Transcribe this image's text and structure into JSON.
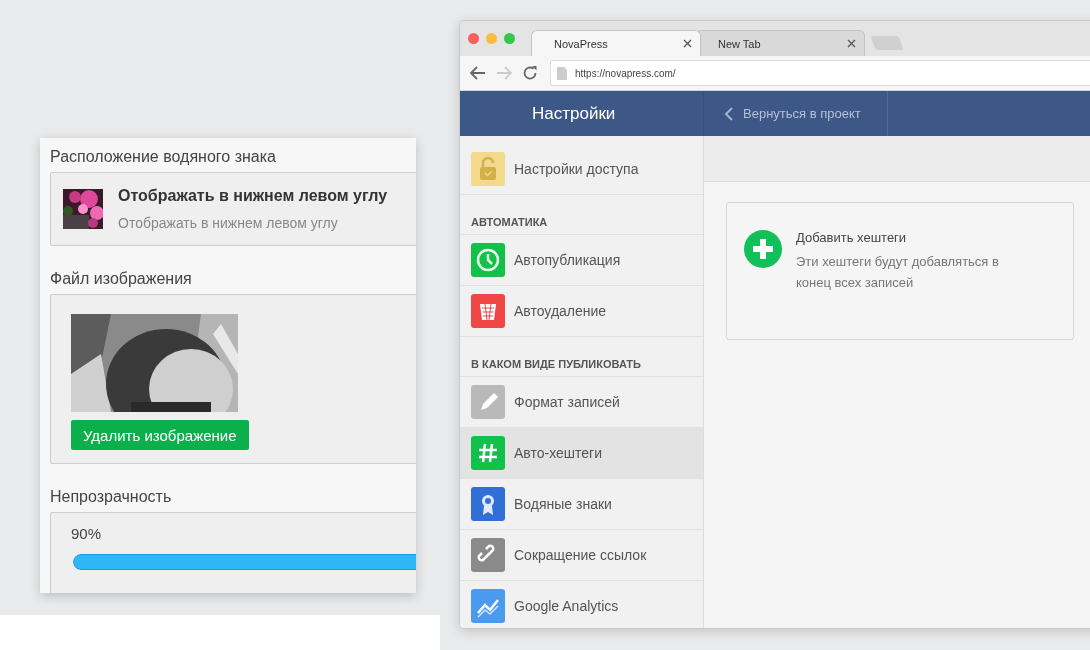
{
  "watermark_panel": {
    "position_label": "Расположение водяного знака",
    "position_option": {
      "title": "Отображать в нижнем левом углу",
      "subtitle": "Отображать в нижнем левом углу"
    },
    "image_label": "Файл изображения",
    "delete_button": "Удалить изображение",
    "opacity_label": "Непрозрачность",
    "opacity_reading": "90%",
    "opacity": {
      "level": 0.9
    }
  },
  "browser": {
    "tabs": [
      {
        "label": "NovaPress",
        "selected": true
      },
      {
        "label": "New Tab",
        "selected": false
      }
    ],
    "url": "https://novapress.com/"
  },
  "app": {
    "title": "Настройки",
    "back_link": "Вернуться в проект",
    "sidebar": [
      {
        "kind": "item",
        "label": "Настройки доступа",
        "selected": false
      },
      {
        "kind": "section",
        "label": "АВТОМАТИКА"
      },
      {
        "kind": "item",
        "label": "Автопубликация",
        "selected": false
      },
      {
        "kind": "item",
        "label": "Автоудаление",
        "selected": false
      },
      {
        "kind": "section",
        "label": "В КАКОМ ВИДЕ ПУБЛИКОВАТЬ"
      },
      {
        "kind": "item",
        "label": "Формат записей",
        "selected": false
      },
      {
        "kind": "item",
        "label": "Авто-хештеги",
        "selected": true
      },
      {
        "kind": "item",
        "label": "Водяные знаки",
        "selected": false
      },
      {
        "kind": "item",
        "label": "Сокращение ссылок",
        "selected": false
      },
      {
        "kind": "item",
        "label": "Google Analytics",
        "selected": false
      }
    ],
    "card": {
      "title": "Добавить хештеги",
      "description": "Эти хештеги будут добавляться в конец всех записей"
    }
  }
}
